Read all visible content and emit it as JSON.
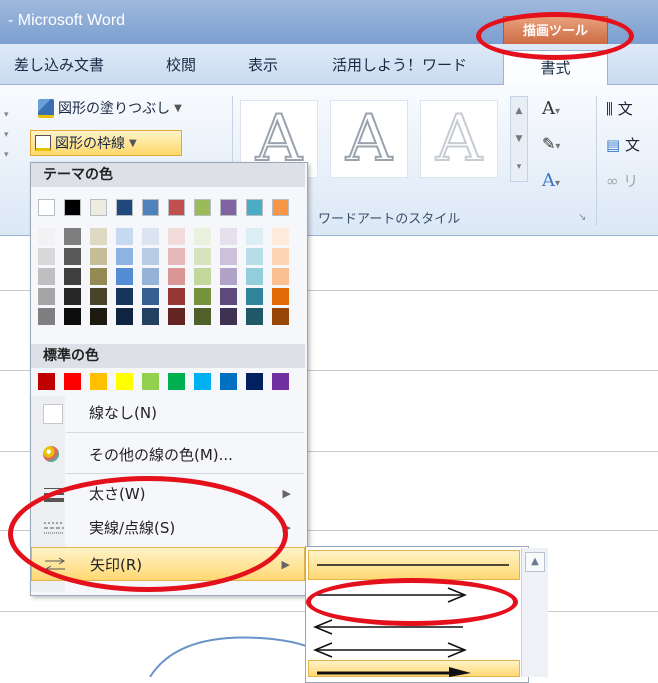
{
  "window": {
    "title": "- Microsoft Word",
    "context_tab": "描画ツール"
  },
  "tabs": [
    "差し込み文書",
    "校閲",
    "表示",
    "活用しよう！ワード",
    "書式"
  ],
  "ribbon": {
    "fill_label": "図形の塗りつぶし",
    "outline_label": "図形の枠線",
    "wordart_glyph": "A",
    "group_label": "ワードアートのスタイル",
    "right_labels": [
      "文",
      "文",
      "リ"
    ]
  },
  "dropdown": {
    "theme_header": "テーマの色",
    "standard_header": "標準の色",
    "no_line": "線なし(N)",
    "more_colors": "その他の線の色(M)...",
    "weight": "太さ(W)",
    "dashes": "実線/点線(S)",
    "arrows": "矢印(R)"
  },
  "colors": {
    "theme": [
      "#ffffff",
      "#000000",
      "#eeece1",
      "#1f497d",
      "#4f81bd",
      "#c0504d",
      "#9bbb59",
      "#8064a2",
      "#4bacc6",
      "#f79646"
    ],
    "theme_shades": [
      [
        "#f2f2f2",
        "#d8d8d8",
        "#bfbfbf",
        "#a5a5a5",
        "#7f7f7f"
      ],
      [
        "#7f7f7f",
        "#595959",
        "#3f3f3f",
        "#262626",
        "#0c0c0c"
      ],
      [
        "#ddd9c3",
        "#c4bd97",
        "#938953",
        "#494429",
        "#1d1b10"
      ],
      [
        "#c6d9f0",
        "#8db3e2",
        "#548dd4",
        "#17365d",
        "#0f243e"
      ],
      [
        "#dbe5f1",
        "#b8cce4",
        "#95b3d7",
        "#366092",
        "#244061"
      ],
      [
        "#f2dcdb",
        "#e5b9b7",
        "#d99694",
        "#953734",
        "#632423"
      ],
      [
        "#ebf1dd",
        "#d7e3bc",
        "#c3d69b",
        "#76923c",
        "#4f6128"
      ],
      [
        "#e5e0ec",
        "#ccc1d9",
        "#b2a2c7",
        "#5f497a",
        "#3f3151"
      ],
      [
        "#dbeef3",
        "#b7dde8",
        "#92cddc",
        "#31859b",
        "#205867"
      ],
      [
        "#fdeada",
        "#fbd5b5",
        "#fac08f",
        "#e36c09",
        "#974806"
      ]
    ],
    "standard": [
      "#c00000",
      "#ff0000",
      "#ffc000",
      "#ffff00",
      "#92d050",
      "#00b050",
      "#00b0f0",
      "#0070c0",
      "#002060",
      "#7030a0"
    ],
    "annotation": "#e4101c"
  }
}
